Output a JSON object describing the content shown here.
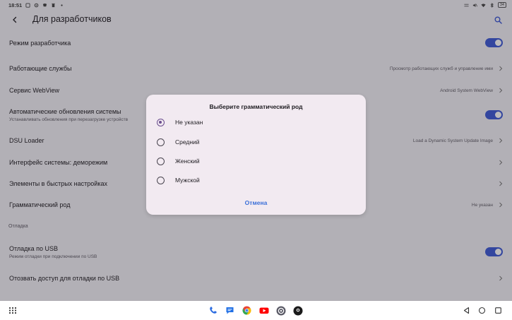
{
  "status_bar": {
    "time": "18:51",
    "battery": "34"
  },
  "header": {
    "title": "Для разработчиков"
  },
  "settings": {
    "developer_mode": {
      "title": "Режим разработчика"
    },
    "running_services": {
      "title": "Работающие службы",
      "value": "Просмотр работающих служб и управление ими"
    },
    "webview": {
      "title": "Сервис WebView",
      "value": "Android System WebView"
    },
    "auto_updates": {
      "title": "Автоматические обновления системы",
      "subtitle": "Устанавливать обновления при перезагрузке устройств"
    },
    "dsu_loader": {
      "title": "DSU Loader",
      "value": "Load a Dynamic System Update Image"
    },
    "demo_mode": {
      "title": "Интерфейс системы: деморежим"
    },
    "quick_settings": {
      "title": "Элементы в быстрых настройках"
    },
    "gender": {
      "title": "Грамматический род",
      "value": "Не указан"
    },
    "debug_section": "Отладка",
    "usb_debug": {
      "title": "Отладка по USB",
      "subtitle": "Режим отладки при подключении по USB"
    },
    "revoke_usb": {
      "title": "Отозвать доступ для отладки по USB"
    }
  },
  "dialog": {
    "title": "Выберите грамматический род",
    "options": [
      {
        "label": "Не указан",
        "selected": true
      },
      {
        "label": "Средний",
        "selected": false
      },
      {
        "label": "Женский",
        "selected": false
      },
      {
        "label": "Мужской",
        "selected": false
      }
    ],
    "cancel_label": "Отмена"
  },
  "dock": {
    "apps": [
      "phone-icon",
      "messages-icon",
      "chrome-icon",
      "youtube-icon",
      "settings-app-icon",
      "camera-icon"
    ]
  },
  "colors": {
    "accent": "#3d5ad6",
    "radio_selected": "#6b4e8f",
    "dialog_background": "#f2eaf1",
    "cancel_button": "#3a6fd8"
  }
}
